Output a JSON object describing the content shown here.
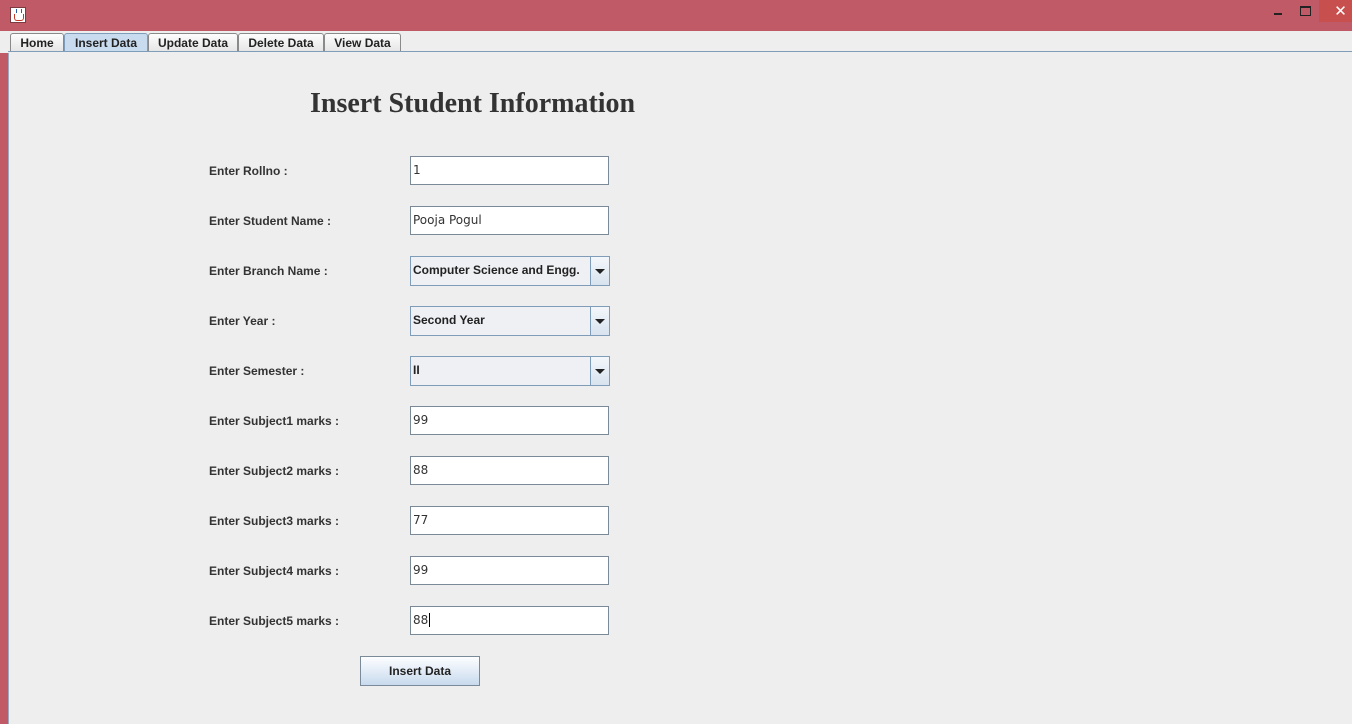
{
  "tabs": [
    {
      "label": "Home"
    },
    {
      "label": "Insert Data"
    },
    {
      "label": "Update Data"
    },
    {
      "label": "Delete Data"
    },
    {
      "label": "View Data"
    }
  ],
  "selected_tab": "Insert Data",
  "form": {
    "title": "Insert Student Information",
    "rollno": {
      "label": "Enter Rollno :",
      "value": "1"
    },
    "name": {
      "label": "Enter Student Name :",
      "value": "Pooja Pogul"
    },
    "branch": {
      "label": "Enter Branch Name :",
      "selected": "Computer Science and Engg."
    },
    "year": {
      "label": "Enter Year :",
      "selected": "Second Year"
    },
    "semester": {
      "label": "Enter Semester :",
      "selected": "II"
    },
    "subject1": {
      "label": "Enter Subject1 marks :",
      "value": "99"
    },
    "subject2": {
      "label": "Enter Subject2 marks :",
      "value": "88"
    },
    "subject3": {
      "label": "Enter Subject3 marks :",
      "value": "77"
    },
    "subject4": {
      "label": "Enter Subject4 marks :",
      "value": "99"
    },
    "subject5": {
      "label": "Enter Subject5 marks :",
      "value": "88"
    },
    "submit_label": "Insert Data"
  },
  "window": {
    "close_glyph": "✕",
    "titlebar_color": "#c05a66",
    "icons": [
      "java-app-icon",
      "minimize-icon",
      "maximize-icon",
      "close-icon",
      "dropdown-arrow-icon"
    ]
  }
}
